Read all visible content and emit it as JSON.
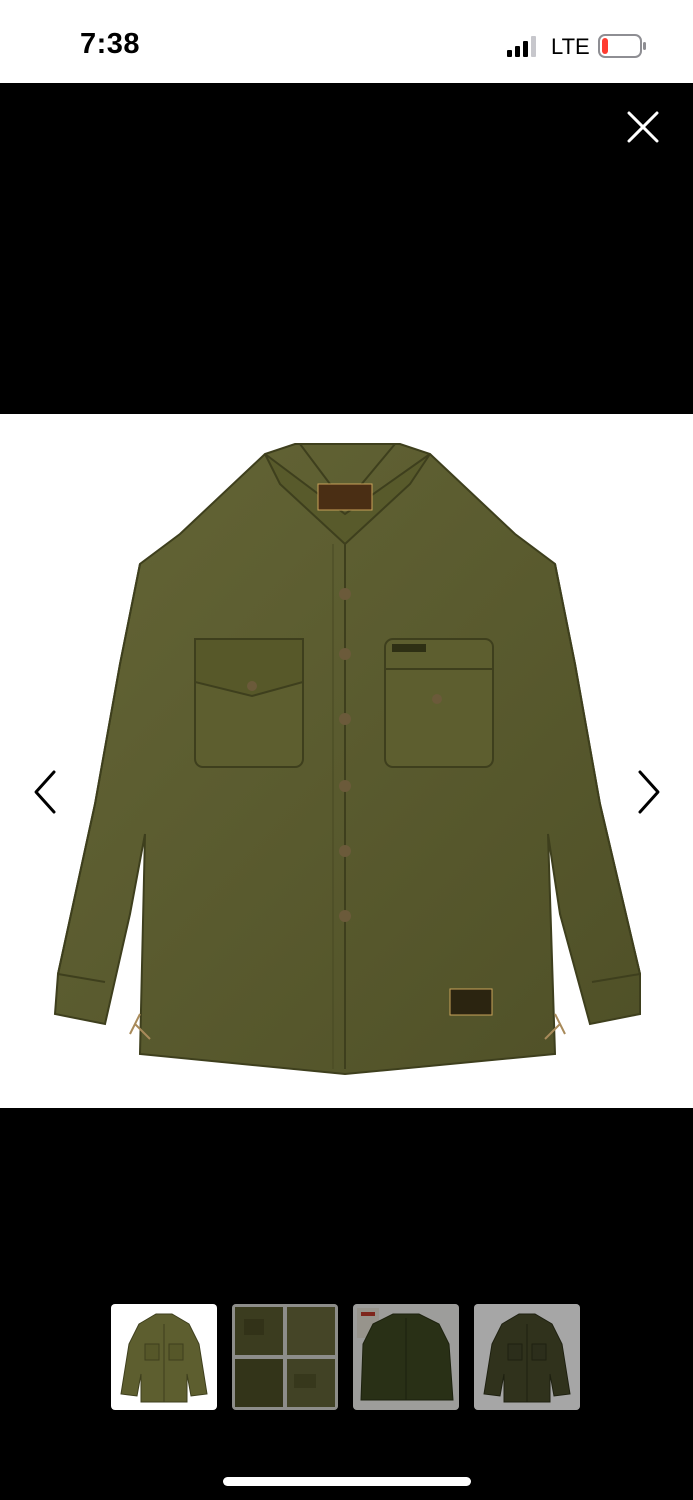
{
  "status_bar": {
    "time": "7:38",
    "network": "LTE",
    "signal_bars_active": 3,
    "battery_level": 0.1,
    "battery_color": "#ff3b30"
  },
  "viewer": {
    "background": "#000000",
    "close_icon": "close-icon",
    "prev_icon": "chevron-left-icon",
    "next_icon": "chevron-right-icon"
  },
  "product": {
    "shirt_color": "#5b5c2e",
    "thumbnails_count": 4,
    "selected_thumbnail": 1
  }
}
